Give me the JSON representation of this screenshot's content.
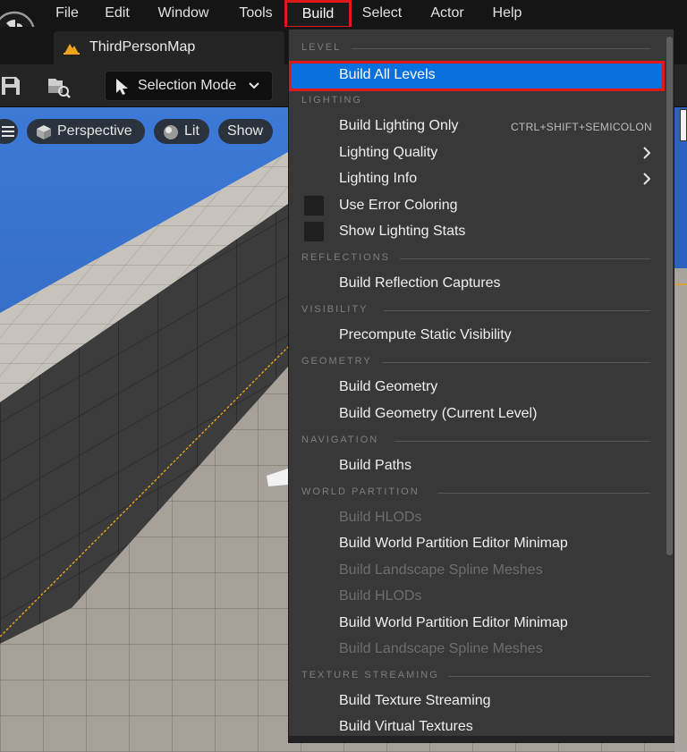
{
  "menubar": {
    "items": [
      "File",
      "Edit",
      "Window",
      "Tools",
      "Build",
      "Select",
      "Actor",
      "Help"
    ],
    "active": "Build"
  },
  "tab": {
    "label": "ThirdPersonMap"
  },
  "toolbar": {
    "selection_mode": "Selection Mode"
  },
  "viewport": {
    "perspective": "Perspective",
    "lit": "Lit",
    "show": "Show"
  },
  "build_menu": {
    "sections": {
      "level": "LEVEL",
      "lighting": "LIGHTING",
      "reflections": "REFLECTIONS",
      "visibility": "VISIBILITY",
      "geometry": "GEOMETRY",
      "navigation": "NAVIGATION",
      "world_partition": "WORLD PARTITION",
      "texture_streaming": "TEXTURE STREAMING"
    },
    "items": {
      "build_all_levels": "Build All Levels",
      "build_lighting_only": "Build Lighting Only",
      "build_lighting_shortcut": "CTRL+SHIFT+SEMICOLON",
      "lighting_quality": "Lighting Quality",
      "lighting_info": "Lighting Info",
      "use_error_coloring": "Use Error Coloring",
      "show_lighting_stats": "Show Lighting Stats",
      "build_reflection_captures": "Build Reflection Captures",
      "precompute_static_visibility": "Precompute Static Visibility",
      "build_geometry": "Build Geometry",
      "build_geometry_current": "Build Geometry (Current Level)",
      "build_paths": "Build Paths",
      "build_hlods": "Build HLODs",
      "build_wp_minimap": "Build World Partition Editor Minimap",
      "build_landscape_spline_meshes": "Build Landscape Spline Meshes",
      "build_texture_streaming": "Build Texture Streaming",
      "build_virtual_textures": "Build Virtual Textures"
    }
  },
  "colors": {
    "highlight": "#0a70dd",
    "annotation": "#e01818",
    "menu_bg": "#383838",
    "sky": "#2e67c4"
  }
}
